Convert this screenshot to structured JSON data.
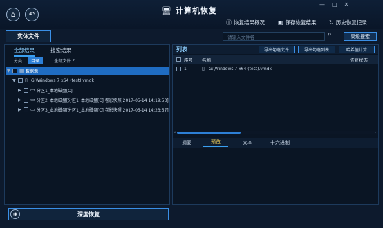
{
  "app": {
    "title": "计算机恢复"
  },
  "toolbar": {
    "overview": "恢复结果概况",
    "save": "保存恢复结果",
    "history": "历史恢复记录"
  },
  "tabs": {
    "entity_file": "实体文件"
  },
  "search": {
    "placeholder": "请输入文件名",
    "advanced": "高级搜索"
  },
  "left": {
    "subtabs": [
      "全部结果",
      "搜索结果"
    ],
    "filters": [
      "分类",
      "目录",
      "全部文件"
    ],
    "tree": [
      {
        "label": "数据源",
        "level": 0,
        "expanded": true,
        "selected": true
      },
      {
        "label": "G:\\Windows 7 x64 (test).vmdk",
        "level": 1,
        "expanded": true,
        "selected": false
      },
      {
        "label": "分区1_本地磁盘[C]",
        "level": 2,
        "expanded": false,
        "selected": false
      },
      {
        "label": "分区2_本地磁盘[分区1_本地磁盘[C] 卷影快照 2017-05-14 14:19:53]",
        "level": 2,
        "expanded": false,
        "selected": false
      },
      {
        "label": "分区3_本地磁盘[分区1_本地磁盘[C] 卷影快照 2017-05-14 14:23:57]",
        "level": 2,
        "expanded": false,
        "selected": false
      }
    ]
  },
  "right": {
    "list_title": "列表",
    "buttons": [
      "导出勾选文件",
      "导出勾选列表",
      "哈希值计算"
    ],
    "columns": [
      "序号",
      "名称",
      "恢复状态"
    ],
    "rows": [
      {
        "index": "1",
        "name": "G:\\Windows 7 x64 (test).vmdk",
        "status": ""
      }
    ],
    "bottom_tabs": [
      "摘要",
      "预览",
      "文本",
      "十六进制"
    ],
    "active_bottom_tab": "预览"
  },
  "bottom": {
    "deep_recover": "深度恢复"
  },
  "colors": {
    "accent": "#3a8fe6",
    "selected": "#1f6cc2",
    "active_tab_text": "#f6d35a"
  }
}
